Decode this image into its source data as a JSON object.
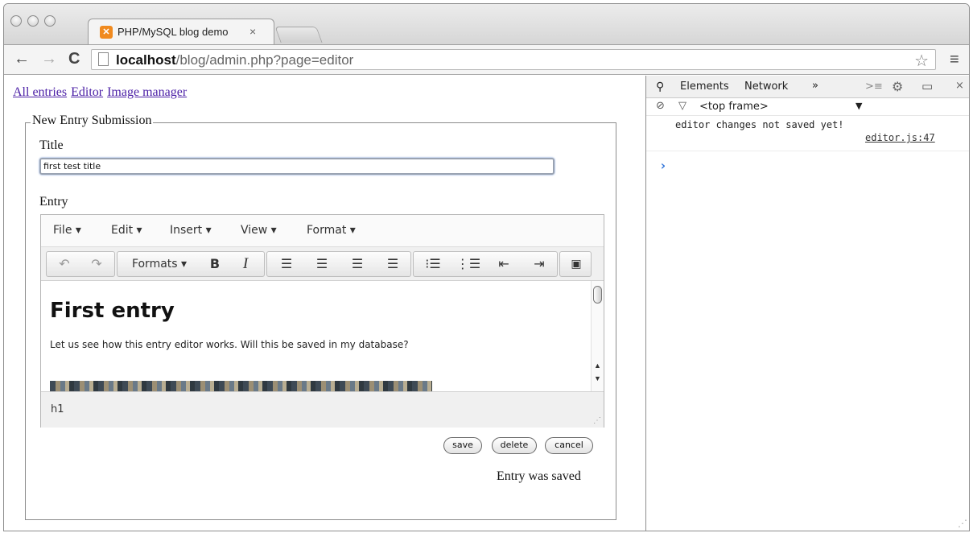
{
  "browser": {
    "tab": {
      "title": "PHP/MySQL blog demo",
      "close": "×",
      "favicon": "xampp-favicon-icon"
    },
    "url": {
      "host": "localhost",
      "path": "/blog/admin.php?page=editor"
    },
    "icons": [
      "back-icon",
      "forward-icon",
      "reload-icon",
      "page-icon",
      "star-icon",
      "menu-icon"
    ]
  },
  "page": {
    "nav": {
      "all": "All entries",
      "editor": "Editor",
      "images": "Image manager"
    },
    "legend": "New Entry Submission",
    "title_label": "Title",
    "title_value": "first test title",
    "entry_label": "Entry",
    "editor": {
      "menus": {
        "file": "File ▾",
        "edit": "Edit ▾",
        "insert": "Insert ▾",
        "view": "View ▾",
        "format": "Format ▾"
      },
      "formats": "Formats ▾",
      "heading": "First entry",
      "paragraph": "Let us see how this entry editor works. Will this be saved in my database?",
      "path": "h1"
    },
    "buttons": {
      "save": "save",
      "delete": "delete",
      "cancel": "cancel"
    },
    "message": "Entry was saved"
  },
  "devtools": {
    "tabs": {
      "elements": "Elements",
      "network": "Network",
      "more": "»"
    },
    "frame": "<top frame>",
    "log": {
      "message": "editor changes not saved yet!",
      "source": "editor.js:47"
    },
    "prompt": "›"
  }
}
